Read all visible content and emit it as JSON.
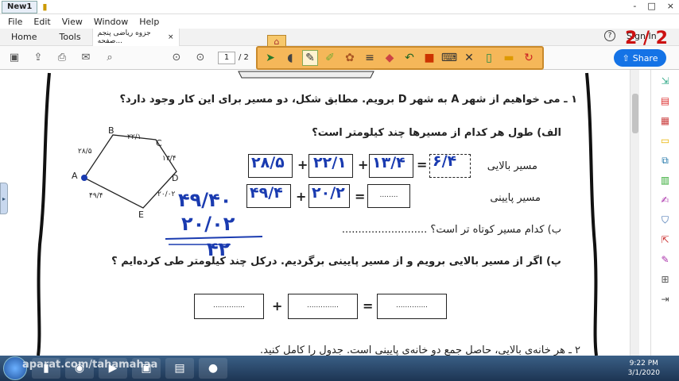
{
  "window": {
    "doc_tab": "New1",
    "controls": [
      "-",
      "□",
      "×"
    ]
  },
  "menu": [
    "File",
    "Edit",
    "View",
    "Window",
    "Help"
  ],
  "tabs": {
    "home": "Home",
    "tools": "Tools",
    "file": "جزوه ریاضی پنجم صفحه...",
    "close": "×"
  },
  "toolbar": {
    "page_current": "1",
    "page_total": "/ 2"
  },
  "header_right": {
    "help": "?",
    "sign_in": "Sign In",
    "page_counter": "2 / 2",
    "share": "Share"
  },
  "document": {
    "q1": "۱ ـ می خواهیم از شهر A به شهر D برویم. مطابق شکل، دو مسیر برای این کار وجود دارد؟",
    "q1a": "الف) طول هر کدام از مسیرها چند کیلومتر است؟",
    "upper_route": "مسیر بالایی",
    "lower_route": "مسیر پایینی",
    "q1b": "ب) کدام مسیر کوتاه تر است؟ ..........................",
    "q1c": "پ) اگر از مسیر بالایی برویم و از مسیر پایینی برگردیم. درکل چند کیلومتر طی کرده‌ایم ؟",
    "q2": "۲ ـ هر خانه‌ی بالایی، حاصل جمع دو خانه‌ی پایینی است. جدول را کامل کنید.",
    "dots": "........",
    "dots_long": "..............",
    "ops": {
      "plus": "+",
      "equals": "="
    },
    "pentagon": {
      "vertices": [
        "A",
        "B",
        "C",
        "D",
        "E"
      ],
      "edges": {
        "AB": "۲۸/۵",
        "BC": "۲۲/۱",
        "CD": "۱۳/۴",
        "DE": "۲۰/۰۲",
        "EA": "۴۹/۴"
      }
    },
    "upper_values": [
      "۶/۴",
      "۱۳/۴",
      "۲۲/۱",
      "۲۸/۵"
    ],
    "lower_values": [
      "۲۰/۲",
      "۴۹/۴"
    ],
    "handwriting": {
      "line1": "۴۹/۴۰",
      "line2": "۲۰/۰۲",
      "result": "۴۲"
    }
  },
  "taskbar": {
    "watermark": "aparat.com/tahamahaa",
    "time": "9:22 PM",
    "date": "3/1/2020"
  }
}
